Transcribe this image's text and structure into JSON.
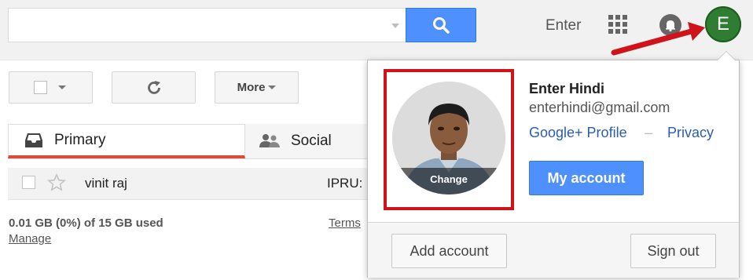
{
  "header": {
    "search": {
      "value": "",
      "placeholder": ""
    },
    "user_name": "Enter",
    "avatar_letter": "E",
    "colors": {
      "search_button": "#4d90fe",
      "avatar": "#2e7d32",
      "annotation": "#d0121b"
    }
  },
  "toolbar": {
    "more_label": "More"
  },
  "tabs": [
    {
      "label": "Primary",
      "icon": "inbox-icon",
      "active": true
    },
    {
      "label": "Social",
      "icon": "people-icon",
      "active": false
    }
  ],
  "email_rows": [
    {
      "sender": "vinit raj",
      "subject": "IPRU:",
      "starred": false
    }
  ],
  "footer": {
    "storage": "0.01 GB (0%) of 15 GB used",
    "manage": "Manage",
    "terms": "Terms"
  },
  "account_popup": {
    "photo_change_label": "Change",
    "name": "Enter Hindi",
    "email": "enterhindi@gmail.com",
    "gplus_label": "Google+ Profile",
    "separator": "–",
    "privacy_label": "Privacy",
    "my_account_label": "My account",
    "add_account_label": "Add account",
    "sign_out_label": "Sign out"
  }
}
